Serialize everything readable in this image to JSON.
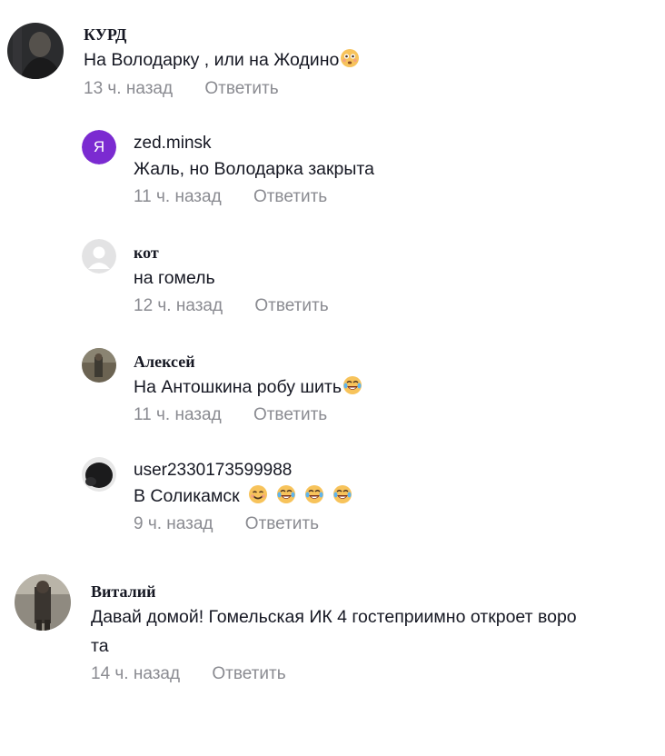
{
  "colors": {
    "name": "#161823",
    "text": "#161823",
    "meta": "#8a8b91",
    "avatar_purple": "#7b2bd1"
  },
  "comments": [
    {
      "username": "КУРД",
      "text": "На Володарку , или на Жодино",
      "emoji": [
        "flushed-face-icon"
      ],
      "time": "13 ч. назад",
      "reply_label": "Ответить"
    },
    {
      "avatar_letter": "Я",
      "username": "zed.minsk",
      "text": "Жаль, но Володарка закрыта",
      "time": "11 ч. назад",
      "reply_label": "Ответить"
    },
    {
      "username": "кот",
      "text": "на гомель",
      "time": "12 ч. назад",
      "reply_label": "Ответить"
    },
    {
      "username": "Алексей",
      "text": "На Антошкина робу шить",
      "emoji": [
        "tears-of-joy-icon"
      ],
      "time": "11 ч. назад",
      "reply_label": "Ответить"
    },
    {
      "username": "user2330173599988",
      "text": "В Соликамск",
      "emoji": [
        "smiling-face-icon",
        "tears-of-joy-icon",
        "tears-of-joy-icon",
        "tears-of-joy-icon"
      ],
      "time": "9 ч. назад",
      "reply_label": "Ответить"
    },
    {
      "username": "Виталий",
      "text_line1": "Давай домой! Гомельская ИК 4 гостеприимно откроет воро",
      "text_line2": "та",
      "time": "14 ч. назад",
      "reply_label": "Ответить"
    }
  ]
}
